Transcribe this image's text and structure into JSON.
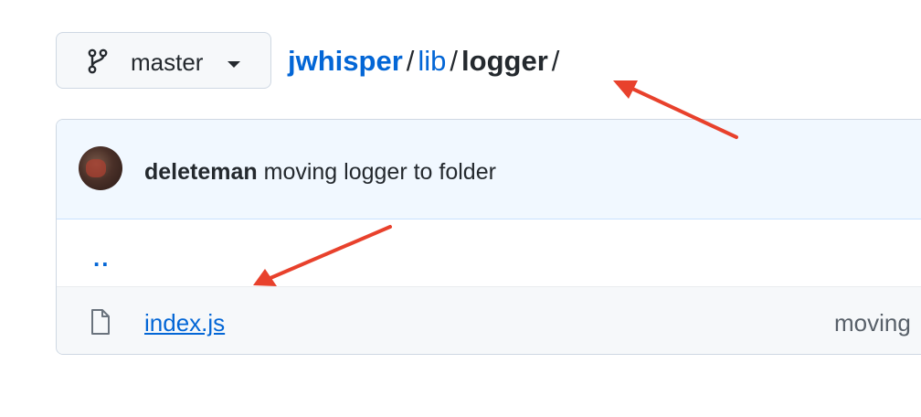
{
  "branch": {
    "label": "master",
    "icon": "git-branch-icon"
  },
  "breadcrumb": {
    "repo": "jwhisper",
    "dir": "lib",
    "current": "logger",
    "separator": "/"
  },
  "commit": {
    "author": "deleteman",
    "message": "moving logger to folder"
  },
  "files": {
    "parent": "..",
    "items": [
      {
        "name": "index.js",
        "icon": "file-icon",
        "last_commit": "moving"
      }
    ]
  },
  "annotations": {
    "arrow_color": "#e8412c"
  },
  "colors": {
    "link": "#0366d6",
    "text": "#24292e",
    "header_bg": "#f1f8ff"
  }
}
